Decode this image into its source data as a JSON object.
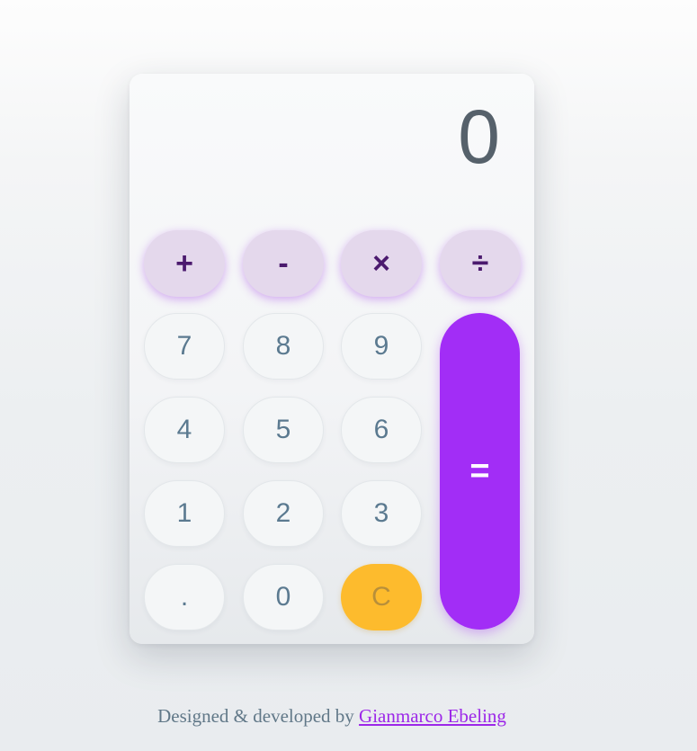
{
  "display": {
    "value": "0"
  },
  "operators": {
    "add": "+",
    "subtract": "-",
    "multiply": "×",
    "divide": "÷"
  },
  "keys": {
    "k7": "7",
    "k8": "8",
    "k9": "9",
    "k4": "4",
    "k5": "5",
    "k6": "6",
    "k1": "1",
    "k2": "2",
    "k3": "3",
    "decimal": ".",
    "k0": "0",
    "clear": "C",
    "equals": "="
  },
  "footer": {
    "prefix": "Designed & developed by ",
    "author": "Gianmarco Ebeling"
  },
  "colors": {
    "operator_bg": "#e4d8ec",
    "operator_text": "#4b1a6e",
    "number_bg": "#f4f6f7",
    "number_text": "#5b7a90",
    "clear_bg": "#fdbb2d",
    "equals_bg": "#a22df6",
    "link": "#9c27e8"
  }
}
